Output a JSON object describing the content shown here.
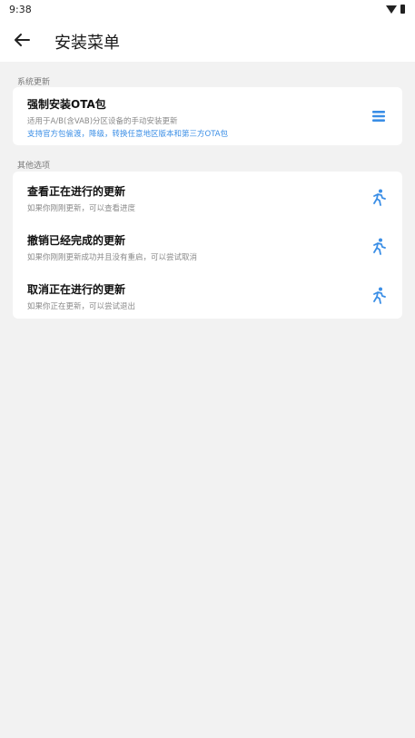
{
  "status_bar": {
    "time": "9:38"
  },
  "header": {
    "title": "安装菜单"
  },
  "sections": [
    {
      "label": "系统更新",
      "items": [
        {
          "title": "强制安装OTA包",
          "subtitle": "适用于A/B(含VAB)分区设备的手动安装更新",
          "note": "支持官方包偷渡，降级，转换任意地区版本和第三方OTA包",
          "icon": "menu-icon"
        }
      ]
    },
    {
      "label": "其他选项",
      "items": [
        {
          "title": "查看正在进行的更新",
          "subtitle": "如果你刚刚更新，可以查看进度",
          "icon": "run-icon"
        },
        {
          "title": "撤销已经完成的更新",
          "subtitle": "如果你刚刚更新成功并且没有重启，可以尝试取消",
          "icon": "run-icon"
        },
        {
          "title": "取消正在进行的更新",
          "subtitle": "如果你正在更新，可以尝试退出",
          "icon": "run-icon"
        }
      ]
    }
  ],
  "colors": {
    "accent": "#3a8ee6",
    "background": "#f2f2f2"
  }
}
